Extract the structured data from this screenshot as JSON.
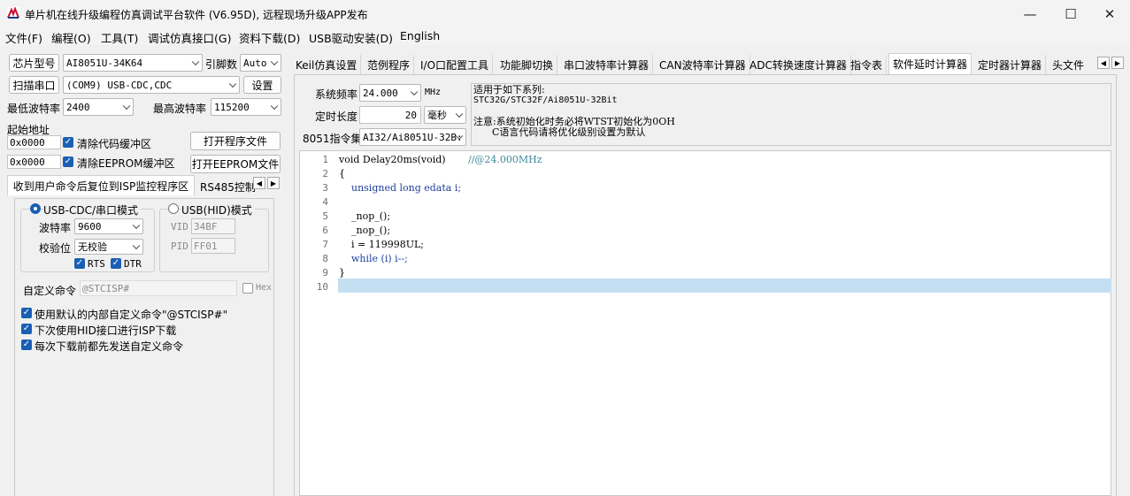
{
  "window": {
    "title": "单片机在线升级编程仿真调试平台软件 (V6.95D), 远程现场升级APP发布",
    "minimize_glyph": "—",
    "maximize_glyph": "☐",
    "close_glyph": "✕"
  },
  "menu": [
    "文件(F)",
    "编程(O)",
    "工具(T)",
    "调试仿真接口(G)",
    "资料下载(D)",
    "USB驱动安装(D)",
    "English"
  ],
  "left": {
    "chip_label": "芯片型号",
    "chip_value": "AI8051U-34K64",
    "pins_label": "引脚数",
    "pins_value": "Auto",
    "scan_port": "扫描串口",
    "port_value": "(COM9) USB-CDC,CDC",
    "settings": "设置",
    "min_baud_label": "最低波特率",
    "min_baud_value": "2400",
    "max_baud_label": "最高波特率",
    "max_baud_value": "115200",
    "start_addr_label": "起始地址",
    "addr1": "0x0000",
    "clear_code": "清除代码缓冲区",
    "open_prog": "打开程序文件",
    "addr2": "0x0000",
    "clear_eeprom": "清除EEPROM缓冲区",
    "open_eeprom": "打开EEPROM文件",
    "tabs": [
      "收到用户命令后复位到ISP监控程序区",
      "RS485控制"
    ],
    "usb_cdc_mode": "USB-CDC/串口模式",
    "usb_hid_mode": "USB(HID)模式",
    "baud_label": "波特率",
    "baud_value": "9600",
    "parity_label": "校验位",
    "parity_value": "无校验",
    "vid_label": "VID",
    "vid_value": "34BF",
    "pid_label": "PID",
    "pid_value": "FF01",
    "rts": "RTS",
    "dtr": "DTR",
    "custom_cmd_label": "自定义命令",
    "custom_cmd_value": "@STCISP#",
    "hex": "Hex",
    "opt1": "使用默认的内部自定义命令\"@STCISP#\"",
    "opt2": "下次使用HID接口进行ISP下载",
    "opt3": "每次下载前都先发送自定义命令"
  },
  "right_tabs": [
    "Keil仿真设置",
    "范例程序",
    "I/O口配置工具",
    "功能脚切换",
    "串口波特率计算器",
    "CAN波特率计算器",
    "ADC转换速度计算器",
    "指令表",
    "软件延时计算器",
    "定时器计算器",
    "头文件"
  ],
  "delay": {
    "freq_label": "系统频率",
    "freq_value": "24.000",
    "freq_unit": "MHz",
    "time_label": "定时长度",
    "time_value": "20",
    "time_unit": "毫秒",
    "iset_label": "8051指令集",
    "iset_value": "AI32/Ai8051U-32B:",
    "info": [
      "适用于如下系列:",
      "STC32G/STC32F/Ai8051U-32Bit",
      "",
      "注意:系统初始化时务必将WTST初始化为0OH",
      "      C语言代码请将优化级别设置为默认"
    ]
  },
  "code": {
    "line_numbers": [
      "1",
      "2",
      "3",
      "4",
      "5",
      "6",
      "7",
      "8",
      "9",
      "10"
    ],
    "l1_code": "void Delay20ms(void)",
    "l1_comment": "//@24.000MHz",
    "l2": "{",
    "l3": "    unsigned long edata i;",
    "l5": "    _nop_();",
    "l6": "    _nop_();",
    "l7": "    i = 119998UL;",
    "l8": "    while (i) i--;",
    "l9": "}"
  }
}
